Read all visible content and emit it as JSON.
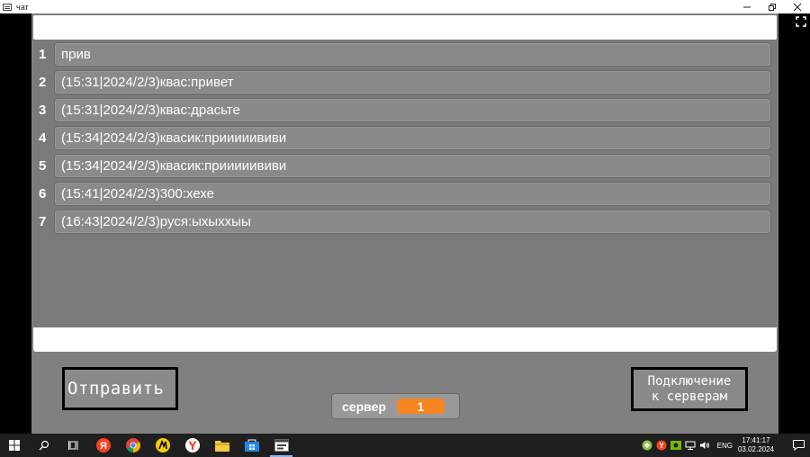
{
  "window": {
    "title": "чат"
  },
  "chat": {
    "messages": [
      {
        "index": "1",
        "text": "прив"
      },
      {
        "index": "2",
        "text": "(15:31|2024/2/3)квас:привет"
      },
      {
        "index": "3",
        "text": "(15:31|2024/2/3)квас:драсьте"
      },
      {
        "index": "4",
        "text": "(15:34|2024/2/3)квасик:прииииививи"
      },
      {
        "index": "5",
        "text": "(15:34|2024/2/3)квасик:прииииививи"
      },
      {
        "index": "6",
        "text": "(15:41|2024/2/3)300:хехе"
      },
      {
        "index": "7",
        "text": "(16:43|2024/2/3)руся:ыхыххыы"
      }
    ]
  },
  "controls": {
    "send_label": "Отправить",
    "connect_label": "Подключение\nк серверам",
    "server_label": "сервер",
    "server_value": "1"
  },
  "taskbar": {
    "icons": [
      "windows-start-icon",
      "search-icon",
      "task-view-icon",
      "yandex-browser-icon",
      "chrome-icon",
      "yandex-market-icon",
      "yandex-icon",
      "file-explorer-icon",
      "store-icon",
      "chat-app-icon"
    ],
    "tray": {
      "language": "ENG",
      "time": "17:41:17",
      "date": "03.02.2024"
    }
  },
  "colors": {
    "stage_bg": "#808080",
    "list_bg": "#7a7a7a",
    "server_value_bg": "#f5861f",
    "taskbar_bg": "#1f1f1f"
  }
}
